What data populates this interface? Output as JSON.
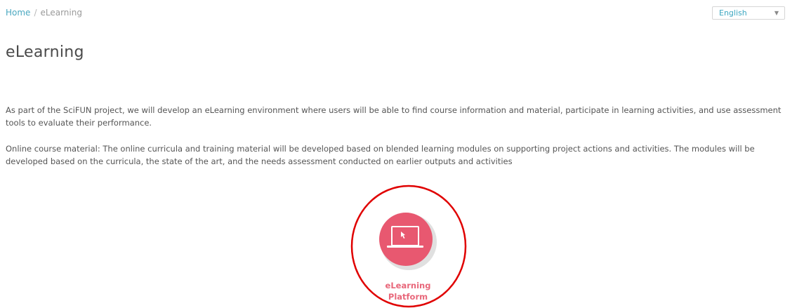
{
  "breadcrumb": {
    "home": "Home",
    "separator": "/",
    "current": "eLearning"
  },
  "language": {
    "selected": "English",
    "caret": "▼"
  },
  "page": {
    "title": "eLearning",
    "paragraphs": [
      "As part of the SciFUN project, we will develop an eLearning environment where users will be able to find course information and material, participate in learning activities, and use assessment tools to evaluate their performance.",
      "Online course material: The online curricula and training material will be developed based on blended learning modules on supporting project actions and activities. The modules will be developed based on the curricula, the state of the art, and the needs assessment conducted on earlier outputs and activities"
    ]
  },
  "tile": {
    "label_line1": "eLearning",
    "label_line2": "Platform",
    "icon": "laptop-icon"
  },
  "colors": {
    "link": "#4aa8c0",
    "tile_circle": "#e85870",
    "tile_label": "#e8677a",
    "highlight_ring": "#e00000"
  }
}
